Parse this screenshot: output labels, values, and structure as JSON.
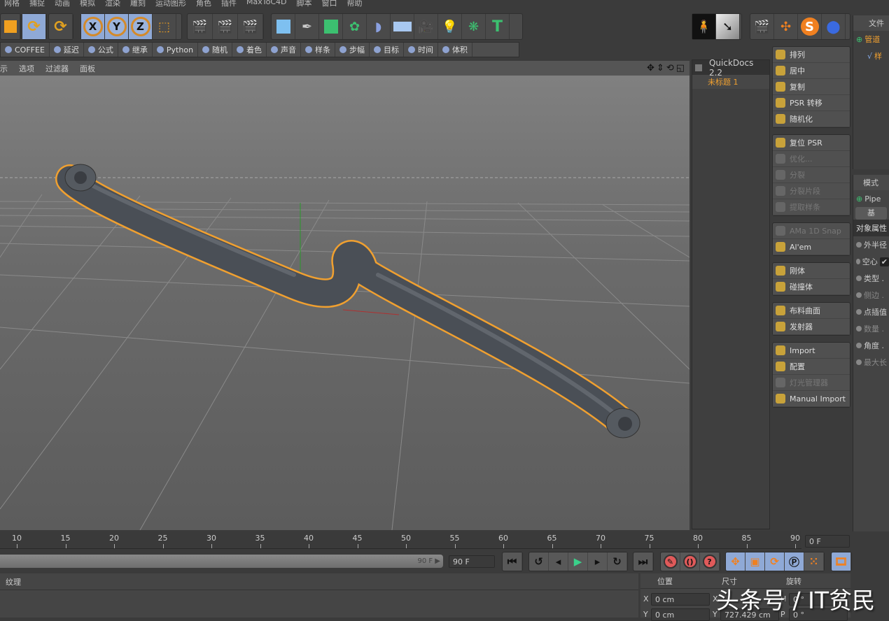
{
  "menu": [
    "网格",
    "捕捉",
    "动画",
    "模拟",
    "渲染",
    "雕刻",
    "运动图形",
    "角色",
    "插件",
    "MaxToC4D",
    "脚本",
    "窗口",
    "帮助"
  ],
  "toolbar": {
    "axis_x": "X",
    "axis_y": "Y",
    "axis_z": "Z"
  },
  "xpresso": [
    "COFFEE",
    "延迟",
    "公式",
    "继承",
    "Python",
    "随机",
    "着色",
    "声音",
    "样条",
    "步幅",
    "目标",
    "时间",
    "体积"
  ],
  "viewport": {
    "menu": [
      "示",
      "选项",
      "过滤器",
      "面板"
    ]
  },
  "quickdocs": {
    "title": "QuickDocs 2.2",
    "doc": "未标题 1"
  },
  "tools": [
    [
      {
        "label": "排列",
        "enabled": true
      },
      {
        "label": "居中",
        "enabled": true
      },
      {
        "label": "复制",
        "enabled": true
      },
      {
        "label": "PSR 转移",
        "enabled": true
      },
      {
        "label": "随机化",
        "enabled": true
      }
    ],
    [
      {
        "label": "复位 PSR",
        "enabled": true
      },
      {
        "label": "优化...",
        "enabled": false
      },
      {
        "label": "分裂",
        "enabled": false
      },
      {
        "label": "分裂片段",
        "enabled": false
      },
      {
        "label": "提取样条",
        "enabled": false
      }
    ],
    [
      {
        "label": "AMa 1D Snap",
        "enabled": false
      },
      {
        "label": "Al'em",
        "enabled": true
      }
    ],
    [
      {
        "label": "刚体",
        "enabled": true
      },
      {
        "label": "碰撞体",
        "enabled": true
      }
    ],
    [
      {
        "label": "布料曲面",
        "enabled": true
      },
      {
        "label": "发射器",
        "enabled": true
      }
    ],
    [
      {
        "label": "Import",
        "enabled": true
      },
      {
        "label": "配置",
        "enabled": true
      },
      {
        "label": "灯光管理器",
        "enabled": false
      },
      {
        "label": "Manual Import",
        "enabled": true
      }
    ]
  ],
  "object_manager": {
    "menu": "文件",
    "object": "管道",
    "child": "样"
  },
  "attributes": {
    "menu": "模式",
    "object": "Pipe",
    "tab": "基",
    "section": "对象属性",
    "rows": [
      {
        "label": "外半径",
        "enabled": true
      },
      {
        "label": "空心",
        "enabled": true,
        "checked": true
      },
      {
        "label": "类型 .",
        "enabled": true
      },
      {
        "label": "侧边 .",
        "enabled": false
      },
      {
        "label": "点插值",
        "enabled": true
      },
      {
        "label": "数量 .",
        "enabled": false
      },
      {
        "label": "角度 .",
        "enabled": true
      },
      {
        "label": "最大长",
        "enabled": false
      }
    ]
  },
  "timeline": {
    "ticks": [
      "10",
      "15",
      "20",
      "25",
      "30",
      "35",
      "40",
      "45",
      "50",
      "55",
      "60",
      "65",
      "70",
      "75",
      "80",
      "85",
      "90"
    ],
    "current_frame": "0 F",
    "end_frame": "90 F",
    "slider_end": "90 F"
  },
  "material": {
    "menu": "纹理"
  },
  "coordinates": {
    "headers": [
      "位置",
      "尺寸",
      "旋转"
    ],
    "x_pos": "0 cm",
    "y_pos": "0 cm",
    "y_size": "727.429 cm",
    "x_rot": "0 °",
    "y_rot": "0 °",
    "labels": {
      "x": "X",
      "y": "Y",
      "h": "H",
      "p": "P"
    }
  },
  "watermark": "头条号 / IT贫民",
  "colors": {
    "accent": "#8fa9d6",
    "selection": "#f0a030",
    "pipe": "#4a4f56"
  }
}
